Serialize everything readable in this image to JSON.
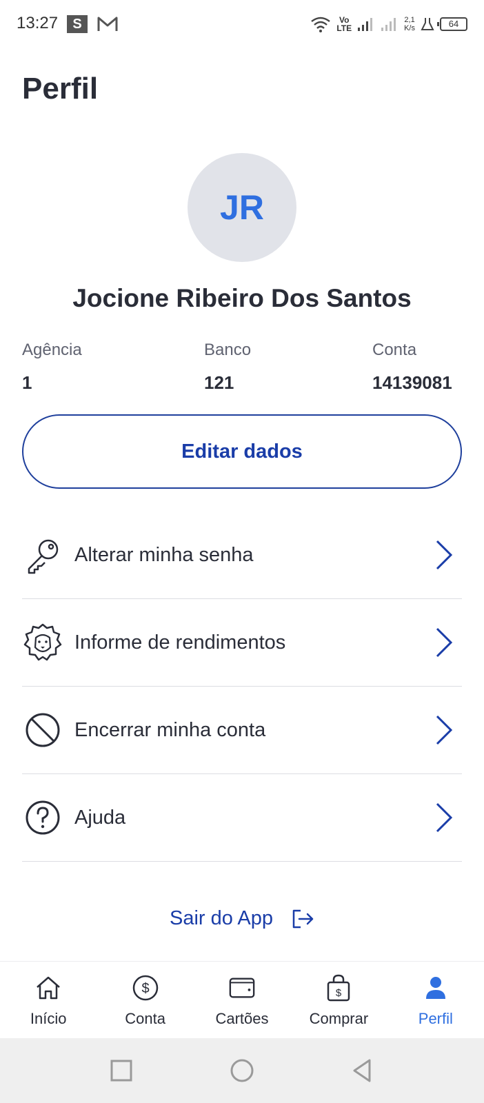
{
  "status_bar": {
    "time": "13:27",
    "s_badge": "S",
    "volte_top": "Vo",
    "volte_bottom": "LTE",
    "speed_top": "2,1",
    "speed_bottom": "K/s",
    "battery": "64"
  },
  "page": {
    "title": "Perfil"
  },
  "profile": {
    "initials": "JR",
    "name": "Jocione Ribeiro Dos Santos",
    "accent_color": "#2f6fe0"
  },
  "account": {
    "agency_label": "Agência",
    "agency_value": "1",
    "bank_label": "Banco",
    "bank_value": "121",
    "account_label": "Conta",
    "account_value": "14139081"
  },
  "edit_button": {
    "label": "Editar dados",
    "color": "#1a3da8"
  },
  "menu": {
    "items": [
      {
        "label": "Alterar minha senha",
        "icon": "key-icon"
      },
      {
        "label": "Informe de rendimentos",
        "icon": "lion-icon"
      },
      {
        "label": "Encerrar minha conta",
        "icon": "block-icon"
      },
      {
        "label": "Ajuda",
        "icon": "help-icon"
      }
    ]
  },
  "logout": {
    "label": "Sair do App",
    "icon": "logout-icon"
  },
  "bottom_nav": {
    "items": [
      {
        "label": "Início",
        "icon": "home-icon"
      },
      {
        "label": "Conta",
        "icon": "dollar-circle-icon"
      },
      {
        "label": "Cartões",
        "icon": "wallet-icon"
      },
      {
        "label": "Comprar",
        "icon": "shopping-bag-icon"
      },
      {
        "label": "Perfil",
        "icon": "person-icon",
        "active": true
      }
    ]
  }
}
